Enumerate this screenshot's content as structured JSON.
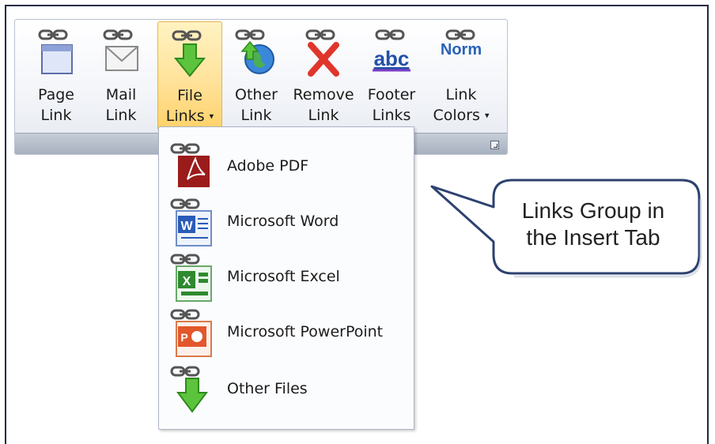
{
  "ribbon": {
    "buttons": [
      {
        "line1": "Page",
        "line2": "Link",
        "has_dropdown": false
      },
      {
        "line1": "Mail",
        "line2": "Link",
        "has_dropdown": false
      },
      {
        "line1": "File",
        "line2": "Links",
        "has_dropdown": true
      },
      {
        "line1": "Other",
        "line2": "Link",
        "has_dropdown": false
      },
      {
        "line1": "Remove",
        "line2": "Link",
        "has_dropdown": false
      },
      {
        "line1": "Footer",
        "line2": "Links",
        "has_dropdown": false
      },
      {
        "line1": "Link",
        "line2": "Colors",
        "has_dropdown": true
      }
    ],
    "footer_text": "abc",
    "norm_text": "Norm"
  },
  "menu": {
    "items": [
      {
        "label": "Adobe PDF"
      },
      {
        "label": "Microsoft Word"
      },
      {
        "label": "Microsoft Excel"
      },
      {
        "label": "Microsoft PowerPoint"
      },
      {
        "label": "Other Files"
      }
    ]
  },
  "callout": {
    "line1": "Links Group in",
    "line2": "the Insert Tab"
  },
  "colors": {
    "frame": "#1f2a44",
    "active_button": "#ffe29a",
    "callout_border": "#2d4270"
  }
}
